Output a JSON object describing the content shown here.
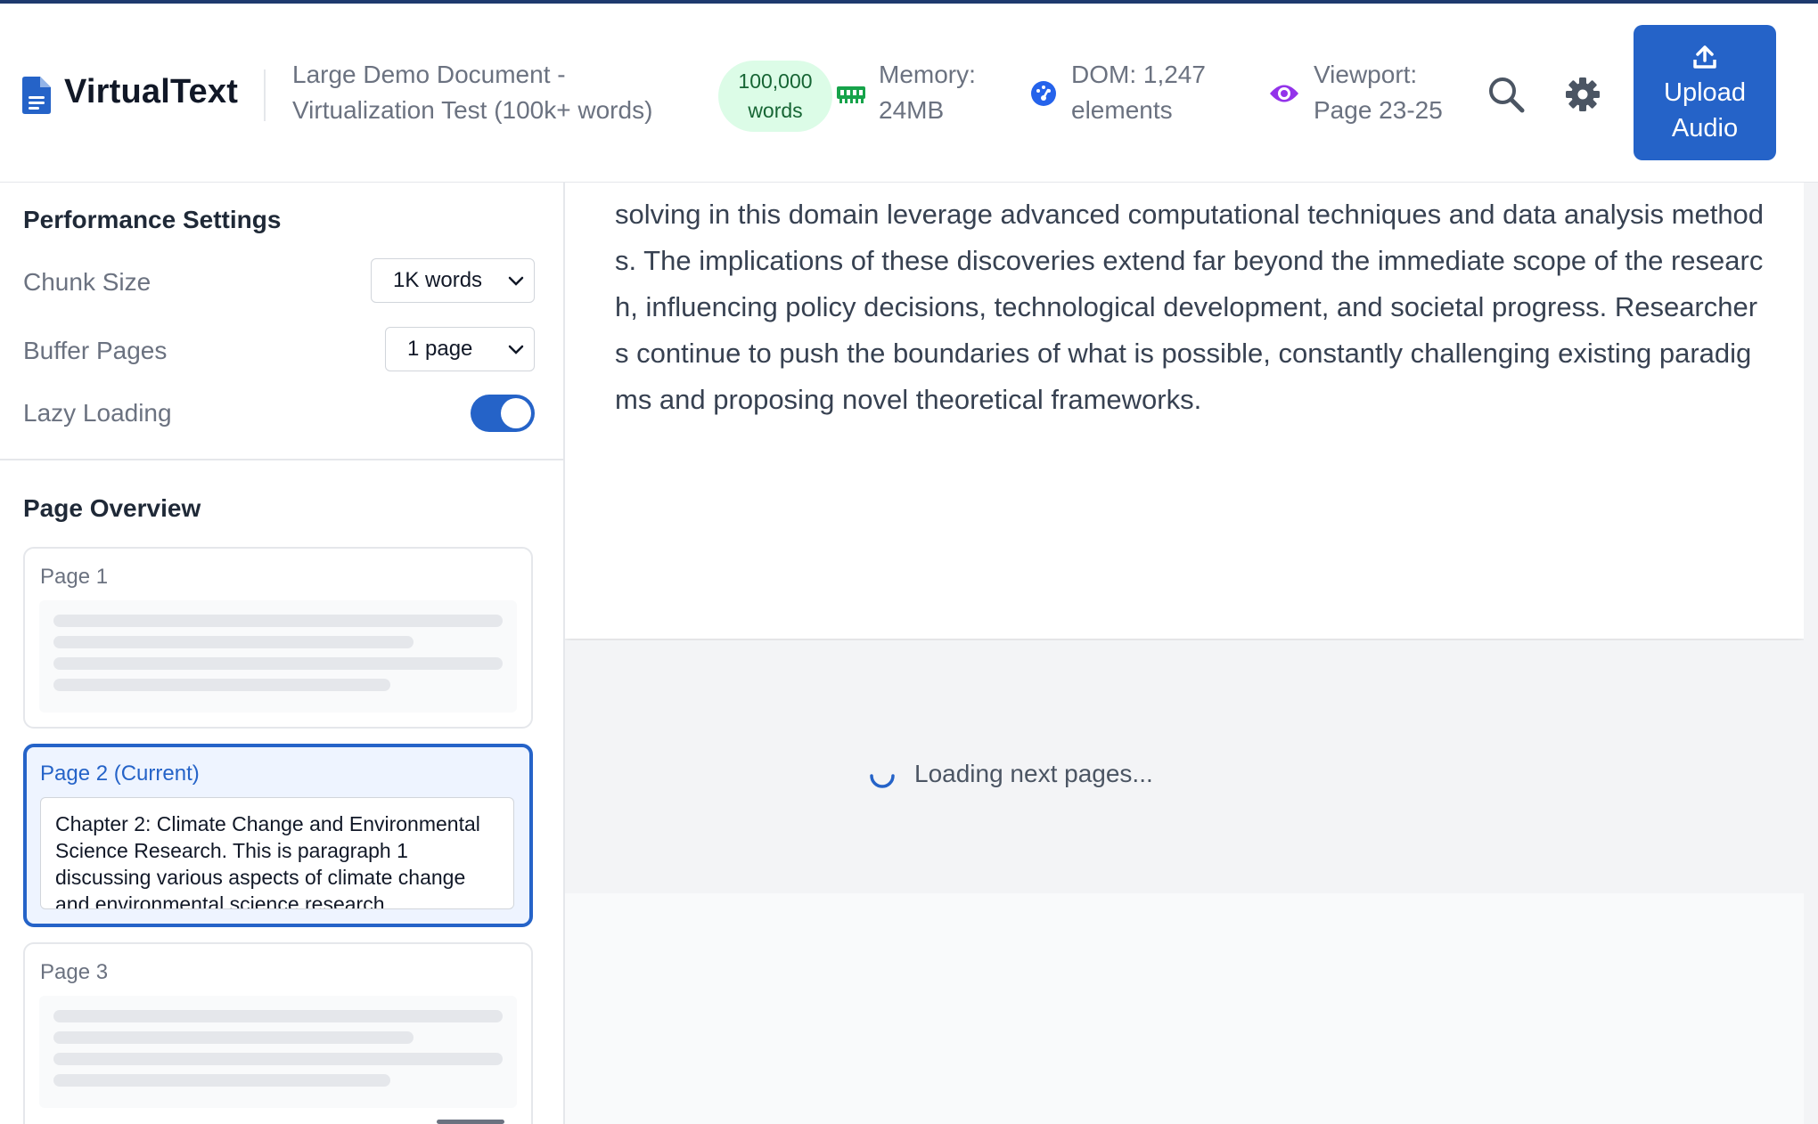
{
  "app": {
    "name": "VirtualText"
  },
  "header": {
    "document_title": "Large Demo Document - Virtualization Test (100k+ words)",
    "word_badge": {
      "line1": "100,000",
      "line2": "words"
    },
    "stats": {
      "memory": {
        "line1": "Memory:",
        "line2": "24MB",
        "icon": "memory-icon"
      },
      "dom": {
        "line1": "DOM: 1,247",
        "line2": "elements",
        "icon": "gauge-icon"
      },
      "viewport": {
        "line1": "Viewport:",
        "line2": "Page 23-25",
        "icon": "eye-icon"
      }
    },
    "upload_button": {
      "line1": "Upload",
      "line2": "Audio"
    }
  },
  "sidebar": {
    "performance_title": "Performance Settings",
    "settings": {
      "chunk_size": {
        "label": "Chunk Size",
        "value": "1K words"
      },
      "buffer_pages": {
        "label": "Buffer Pages",
        "value": "1 page"
      },
      "lazy_loading": {
        "label": "Lazy Loading",
        "enabled": true
      }
    },
    "overview_title": "Page Overview",
    "pages": [
      {
        "label": "Page 1",
        "state": "loading"
      },
      {
        "label": "Page 2 (Current)",
        "state": "current",
        "preview": "Chapter 2: Climate Change and Environmental Science Research. This is paragraph 1 discussing various aspects of climate change and environmental science research."
      },
      {
        "label": "Page 3",
        "state": "loading"
      }
    ]
  },
  "main": {
    "visible_text": "solving in this domain leverage advanced computational techniques and data analysis methods. The implications of these discoveries extend far beyond the immediate scope of the research, influencing policy decisions, technological development, and societal progress. Researchers continue to push the boundaries of what is possible, constantly challenging existing paradigms and proposing novel theoretical frameworks.",
    "loading_text": "Loading next pages..."
  },
  "colors": {
    "accent": "#2563c8",
    "badge_bg": "#dcfce7",
    "badge_text": "#166534",
    "memory_icon": "#16a34a",
    "dom_icon": "#2563eb",
    "viewport_icon": "#9333ea"
  }
}
